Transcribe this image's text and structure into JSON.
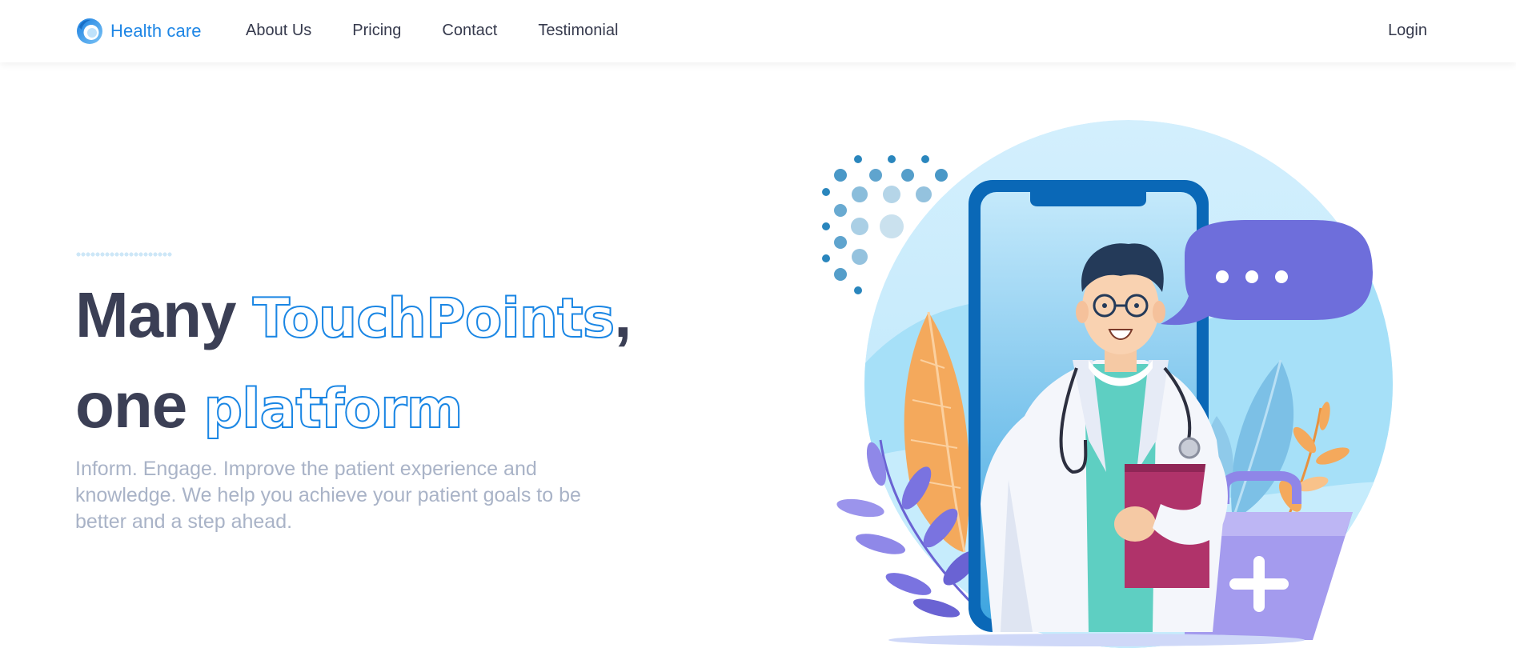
{
  "brand": {
    "name": "Health care",
    "icon": "swirl-logo-icon"
  },
  "nav": {
    "links": [
      {
        "label": "About Us"
      },
      {
        "label": "Pricing"
      },
      {
        "label": "Contact"
      },
      {
        "label": "Testimonial"
      }
    ],
    "login_label": "Login"
  },
  "hero": {
    "headline_line1_plain": "Many ",
    "headline_line1_accent": "TouchPoints",
    "headline_line1_suffix": ",",
    "headline_line2_plain": "one ",
    "headline_line2_accent": "platform",
    "subtitle": "Inform. Engage. Improve the patient experience and knowledge. We help you achieve your patient goals to be better and a step ahead.",
    "illustration": "doctor-on-smartphone-illustration"
  },
  "colors": {
    "brand_blue": "#1e86e5",
    "heading": "#3b3f55",
    "subtitle": "#a9b3c7",
    "chat_bubble": "#6e6edb",
    "clipboard": "#b0336a",
    "phone_frame": "#0a68b7"
  }
}
